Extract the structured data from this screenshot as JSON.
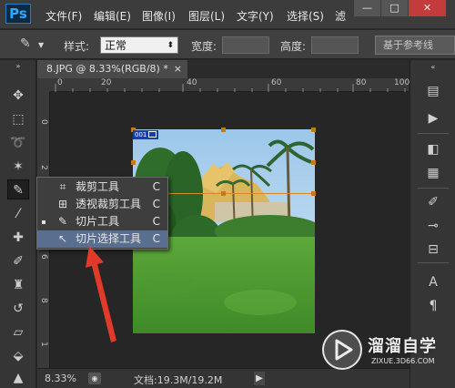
{
  "app": {
    "logo": "Ps"
  },
  "menu": {
    "items": [
      "文件(F)",
      "编辑(E)",
      "图像(I)",
      "图层(L)",
      "文字(Y)",
      "选择(S)",
      "滤"
    ]
  },
  "window_controls": {
    "minimize": "—",
    "maximize": "□",
    "close": "✕"
  },
  "options_bar": {
    "style_label": "样式:",
    "style_value": "正常",
    "width_label": "宽度:",
    "height_label": "高度:",
    "guides_button": "基于参考线"
  },
  "document": {
    "tab_title": "8.JPG @ 8.33%(RGB/8) *",
    "tab_close": "×",
    "slice_badge": "001"
  },
  "ruler": {
    "h_labels": [
      "0",
      "20",
      "40",
      "60",
      "80",
      "100"
    ],
    "v_labels": [
      "0",
      "2",
      "4",
      "6",
      "8",
      "1"
    ]
  },
  "flyout": {
    "items": [
      {
        "label": "裁剪工具",
        "key": "C",
        "icon": "crop-icon"
      },
      {
        "label": "透视裁剪工具",
        "key": "C",
        "icon": "perspective-crop-icon"
      },
      {
        "label": "切片工具",
        "key": "C",
        "icon": "slice-icon"
      },
      {
        "label": "切片选择工具",
        "key": "C",
        "icon": "slice-select-icon"
      }
    ]
  },
  "status_bar": {
    "zoom": "8.33%",
    "doc_info": "文档:19.3M/19.2M",
    "arrow": "▶"
  },
  "watermark": {
    "title": "溜溜自学",
    "subtitle": "ZIXUE.3D66.COM"
  },
  "colors": {
    "accent_orange": "#d68a2a",
    "arrow_red": "#e23a2a",
    "flyout_hover": "#5a6f8f"
  }
}
